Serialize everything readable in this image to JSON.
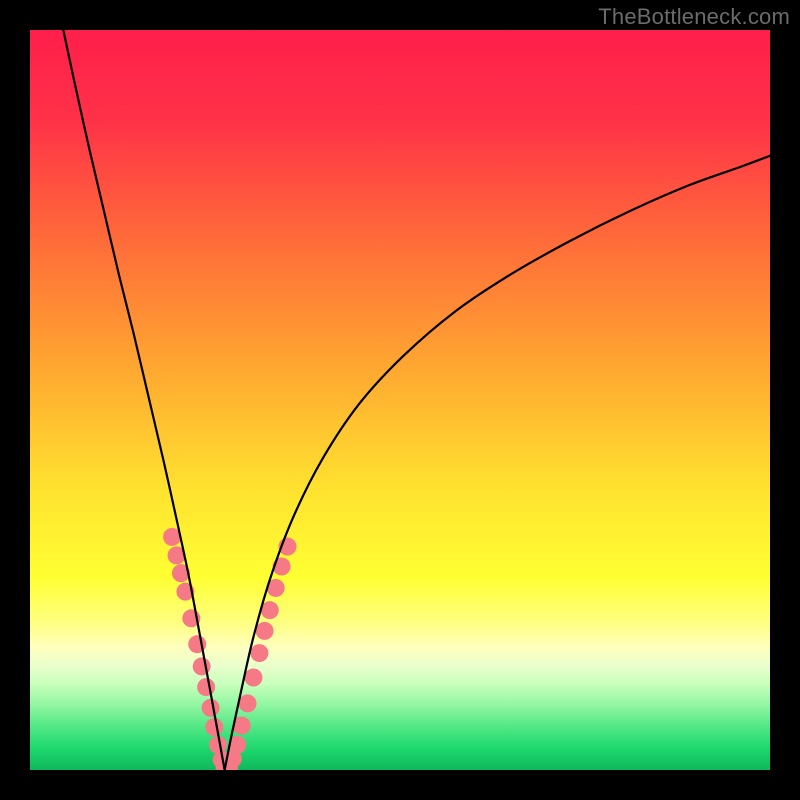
{
  "watermark": "TheBottleneck.com",
  "chart_data": {
    "type": "line",
    "title": "",
    "xlabel": "",
    "ylabel": "",
    "xlim": [
      0,
      100
    ],
    "ylim": [
      0,
      100
    ],
    "grid": false,
    "legend": null,
    "gradient_stops": [
      {
        "pos": 0.0,
        "color": "#ff1f4b"
      },
      {
        "pos": 0.12,
        "color": "#ff3148"
      },
      {
        "pos": 0.28,
        "color": "#ff6a3a"
      },
      {
        "pos": 0.45,
        "color": "#ffa531"
      },
      {
        "pos": 0.62,
        "color": "#ffe22f"
      },
      {
        "pos": 0.74,
        "color": "#ffff33"
      },
      {
        "pos": 0.8,
        "color": "#ffff80"
      },
      {
        "pos": 0.835,
        "color": "#ffffc0"
      },
      {
        "pos": 0.86,
        "color": "#e8ffcc"
      },
      {
        "pos": 0.885,
        "color": "#c6ffbb"
      },
      {
        "pos": 0.91,
        "color": "#96f7a4"
      },
      {
        "pos": 0.94,
        "color": "#55e886"
      },
      {
        "pos": 0.97,
        "color": "#1ed96f"
      },
      {
        "pos": 1.0,
        "color": "#0fb85b"
      }
    ],
    "series": [
      {
        "name": "left-branch",
        "color": "#000000",
        "width": 2.2,
        "x": [
          4.5,
          6,
          8,
          10,
          12,
          14,
          16,
          18,
          20,
          21.5,
          23,
          24.3,
          25.4,
          26.3
        ],
        "y": [
          100,
          93,
          84,
          75.5,
          67,
          59,
          50.5,
          42,
          33,
          26,
          18,
          11,
          5,
          0
        ]
      },
      {
        "name": "right-branch",
        "color": "#000000",
        "width": 2.2,
        "x": [
          26.3,
          27.3,
          28.6,
          30.2,
          32.5,
          35.5,
          39.5,
          44.5,
          50.5,
          57.5,
          65,
          73,
          81,
          89,
          96,
          100
        ],
        "y": [
          0,
          5,
          11,
          18,
          26,
          34,
          42,
          49.5,
          56,
          62,
          67,
          71.5,
          75.5,
          79,
          81.5,
          83
        ]
      }
    ],
    "scatter": {
      "name": "marker-cloud",
      "color": "#f57a86",
      "radius": 9,
      "points": [
        [
          19.2,
          31.5
        ],
        [
          19.8,
          29.0
        ],
        [
          20.4,
          26.6
        ],
        [
          21.0,
          24.1
        ],
        [
          21.8,
          20.5
        ],
        [
          22.6,
          17.0
        ],
        [
          23.2,
          14.0
        ],
        [
          23.8,
          11.2
        ],
        [
          24.4,
          8.4
        ],
        [
          24.9,
          5.8
        ],
        [
          25.4,
          3.4
        ],
        [
          25.9,
          1.4
        ],
        [
          26.3,
          0.2
        ],
        [
          26.9,
          0.3
        ],
        [
          27.4,
          1.5
        ],
        [
          28.0,
          3.4
        ],
        [
          28.6,
          6.0
        ],
        [
          29.4,
          9.0
        ],
        [
          30.2,
          12.5
        ],
        [
          31.0,
          15.8
        ],
        [
          31.7,
          18.8
        ],
        [
          32.4,
          21.6
        ],
        [
          33.2,
          24.6
        ],
        [
          34.0,
          27.5
        ],
        [
          34.8,
          30.2
        ]
      ]
    }
  }
}
